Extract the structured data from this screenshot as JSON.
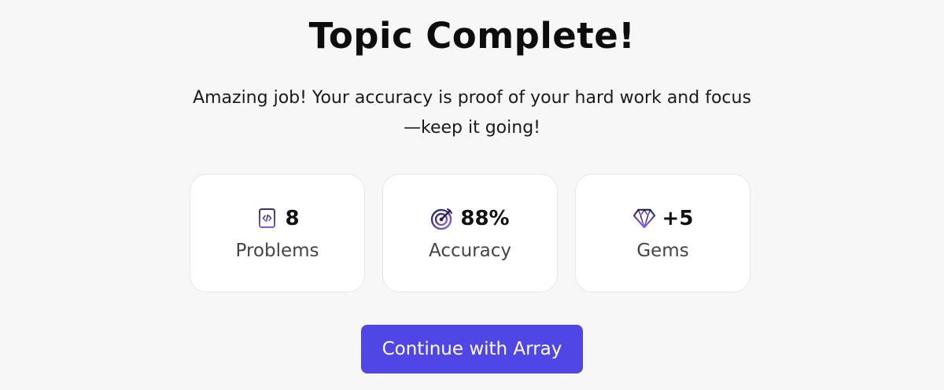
{
  "header": {
    "title": "Topic Complete!",
    "message": "Amazing job! Your accuracy is proof of your hard work and focus—keep it going!"
  },
  "stats": [
    {
      "icon": "code-notebook-icon",
      "value": "8",
      "label": "Problems"
    },
    {
      "icon": "target-icon",
      "value": "88%",
      "label": "Accuracy"
    },
    {
      "icon": "gem-icon",
      "value": "+5",
      "label": "Gems"
    }
  ],
  "actions": {
    "continue_label": "Continue with Array"
  },
  "colors": {
    "accent": "#4f46e5",
    "background": "#f7f7f7",
    "card": "#ffffff",
    "icon_dark": "#1e1b4b",
    "icon_light": "#8b5cf6"
  }
}
